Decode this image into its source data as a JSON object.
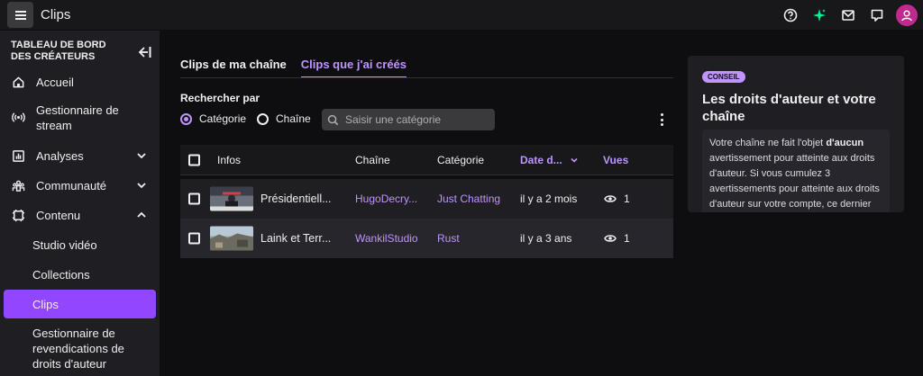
{
  "header": {
    "title": "Clips",
    "icons": [
      "menu-icon",
      "help-icon",
      "sparkle-icon",
      "inbox-icon",
      "whispers-icon",
      "avatar-icon"
    ]
  },
  "sidebar": {
    "header": "TABLEAU DE BORD DES CRÉATEURS",
    "items": [
      {
        "label": "Accueil",
        "icon": "home-icon"
      },
      {
        "label": "Gestionnaire de stream",
        "icon": "broadcast-icon"
      },
      {
        "label": "Analyses",
        "icon": "analytics-icon"
      },
      {
        "label": "Communauté",
        "icon": "community-icon"
      },
      {
        "label": "Contenu",
        "icon": "content-icon"
      }
    ],
    "sub_items": [
      {
        "label": "Studio vidéo"
      },
      {
        "label": "Collections"
      },
      {
        "label": "Clips"
      },
      {
        "label": "Gestionnaire de revendications de droits d'auteur"
      }
    ]
  },
  "main": {
    "tabs": [
      "Clips de ma chaîne",
      "Clips que j'ai créés"
    ],
    "active_tab": "Clips que j'ai créés",
    "search_by_label": "Rechercher par",
    "radio_category": "Catégorie",
    "radio_channel": "Chaîne",
    "search_placeholder": "Saisir une catégorie",
    "table": {
      "headers": {
        "infos": "Infos",
        "chaine": "Chaîne",
        "categorie": "Catégorie",
        "date": "Date d...",
        "vues": "Vues"
      },
      "rows": [
        {
          "title": "Présidentiell...",
          "channel": "HugoDecry...",
          "category": "Just Chatting",
          "date": "il y a 2 mois",
          "views": "1"
        },
        {
          "title": "Laink et Terr...",
          "channel": "WankilStudio",
          "category": "Rust",
          "date": "il y a 3 ans",
          "views": "1"
        }
      ]
    }
  },
  "tip": {
    "badge": "CONSEIL",
    "title": "Les droits d'auteur et votre chaîne",
    "body_pre": "Votre chaîne ne fait l'objet ",
    "body_bold": "d'aucun",
    "body_post": " avertissement pour atteinte aux droits d'auteur. Si vous cumulez 3 avertissements pour atteinte aux droits d'auteur sur votre compte, ce dernier risque la suppression."
  },
  "colors": {
    "accent": "#9147ff",
    "accent_light": "#bf94ff",
    "background": "#0e0e10",
    "panel": "#1f1f23",
    "avatar": "#c02a8f"
  }
}
